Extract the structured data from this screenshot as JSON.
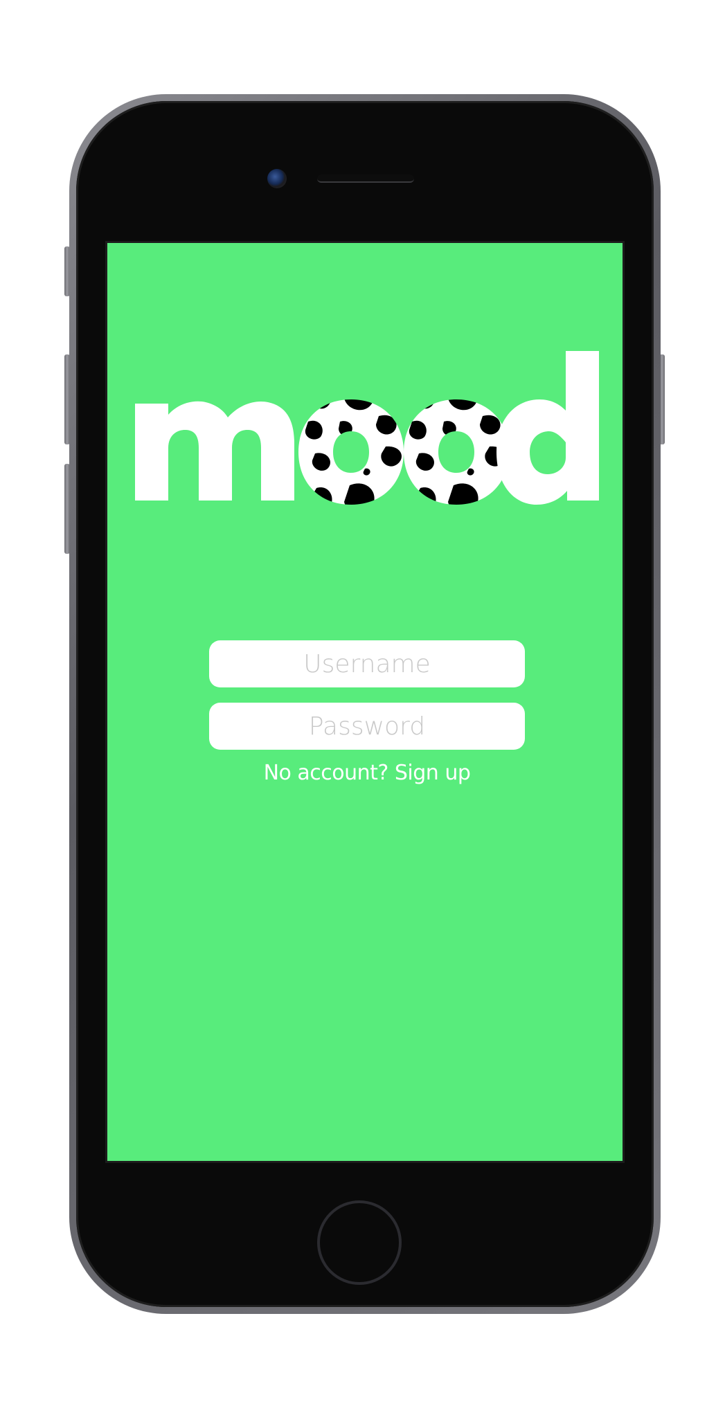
{
  "app": {
    "logo_text": "mood",
    "brand_color": "#58ec7c",
    "logo_pattern": "cow-print"
  },
  "login": {
    "username_placeholder": "Username",
    "password_placeholder": "Password",
    "no_account_text": "No account?",
    "signup_link": "Sign up"
  },
  "device": {
    "type": "phone-mockup",
    "frame_color": "#6e6e74"
  }
}
